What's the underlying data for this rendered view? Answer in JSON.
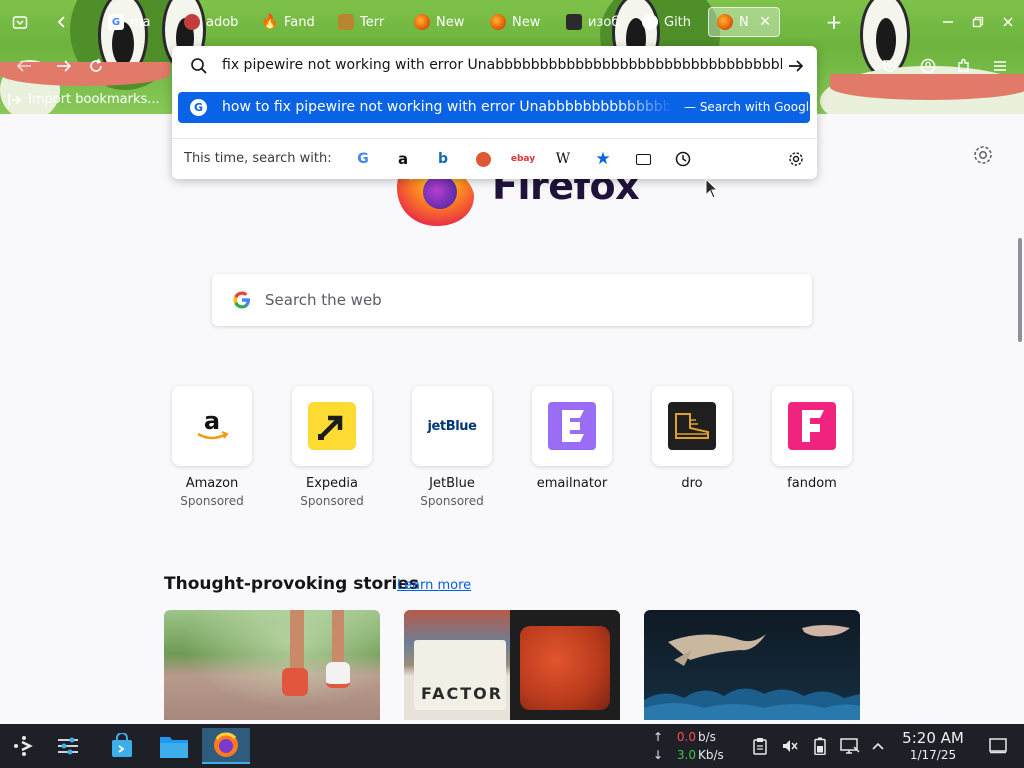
{
  "browser": {
    "tabs": [
      {
        "label": "ma",
        "favicon": "google-icon",
        "color": "#ffffff"
      },
      {
        "label": "adob",
        "favicon": "adobe-icon",
        "color": "#c43d3d"
      },
      {
        "label": "Fand",
        "favicon": "fandom-icon",
        "color": "#e8322d"
      },
      {
        "label": "Terr",
        "favicon": "terraria-icon",
        "color": "#b8862e"
      },
      {
        "label": "New",
        "favicon": "firefox-icon",
        "color": "#e66000"
      },
      {
        "label": "New",
        "favicon": "firefox-icon",
        "color": "#e66000"
      },
      {
        "label": "изоб",
        "favicon": "terminal-icon",
        "color": "#2b2b2b"
      },
      {
        "label": "Gith",
        "favicon": "github-icon",
        "color": "#ffffff"
      },
      {
        "label": "N",
        "favicon": "firefox-icon",
        "color": "#e66000"
      }
    ],
    "bookmarks_label": "Import bookmarks...",
    "url_value": "fix pipewire not working with error Unabbbbbbbbbbbbbbbbbbbbbbbbbbbbbbbbbbbbb",
    "suggestion_text": "how to fix pipewire not working with error Unabbbbbbbbbbbbbbbbbbbbbbbbbbbbbbbbbbbbbb",
    "suggestion_action": "— Search with Google",
    "oneoff_label": "This time, search with:",
    "engines": [
      "google-icon",
      "amazon-icon",
      "bing-icon",
      "duckduckgo-icon",
      "ebay-icon",
      "wikipedia-icon",
      "bookmarks-star-icon",
      "tabs-icon",
      "history-icon"
    ]
  },
  "newtab": {
    "wordmark": "Firefox",
    "search_placeholder": "Search the web",
    "shortcuts": [
      {
        "name": "Amazon",
        "sponsored": "Sponsored",
        "icon": "amazon-icon"
      },
      {
        "name": "Expedia",
        "sponsored": "Sponsored",
        "icon": "expedia-icon"
      },
      {
        "name": "JetBlue",
        "sponsored": "Sponsored",
        "icon": "jetblue-icon",
        "logo_text": "jetBlue"
      },
      {
        "name": "emailnator",
        "sponsored": "",
        "icon": "emailnator-icon"
      },
      {
        "name": "dro",
        "sponsored": "",
        "icon": "boot-icon"
      },
      {
        "name": "fandom",
        "sponsored": "",
        "icon": "fandom-icon"
      }
    ],
    "stories_heading": "Thought-provoking stories",
    "stories_link": "Learn more",
    "story_factor_text": "FACTOR"
  },
  "taskbar": {
    "upload_value": "0.0",
    "upload_unit": "b/s",
    "download_value": "3.0",
    "download_unit": "Kb/s",
    "time": "5:20 AM",
    "date": "1/17/25",
    "colors": {
      "upload": "#ff4d4d",
      "download": "#3ec93e"
    }
  }
}
